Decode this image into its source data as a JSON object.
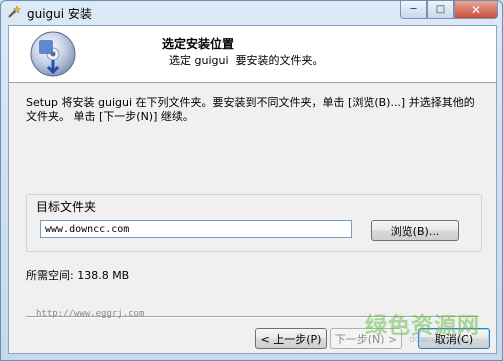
{
  "window": {
    "title": "guigui 安装",
    "controls": {
      "minimize": "─",
      "maximize": "□",
      "close": "✕"
    }
  },
  "header": {
    "title": "选定安装位置",
    "subtitle": "选定 guigui  要安装的文件夹。"
  },
  "body": {
    "description": "Setup 将安装 guigui 在下列文件夹。要安装到不同文件夹，单击 [浏览(B)...] 并选择其他的文件夹。 单击 [下一步(N)] 继续。",
    "destination_label": "目标文件夹",
    "destination_value": "www.downcc.com",
    "browse_label": "浏览(B)...",
    "space_required": "所需空间: 138.8 MB",
    "url_text": "http://www.eggrj.com"
  },
  "footer": {
    "back_label": "< 上一步(P)",
    "next_label": "下一步(N) >",
    "cancel_label": "取消(C)"
  },
  "watermark": {
    "main": "绿色资源网",
    "sub": "downcc.com"
  },
  "colors": {
    "title_bar": "#c9dcef",
    "close_button": "#c7503a",
    "header_background": "#ffffff",
    "client_background": "#f0f0f0"
  },
  "icons": {
    "app": "installer-wand-icon",
    "header": "disc-install-icon"
  }
}
